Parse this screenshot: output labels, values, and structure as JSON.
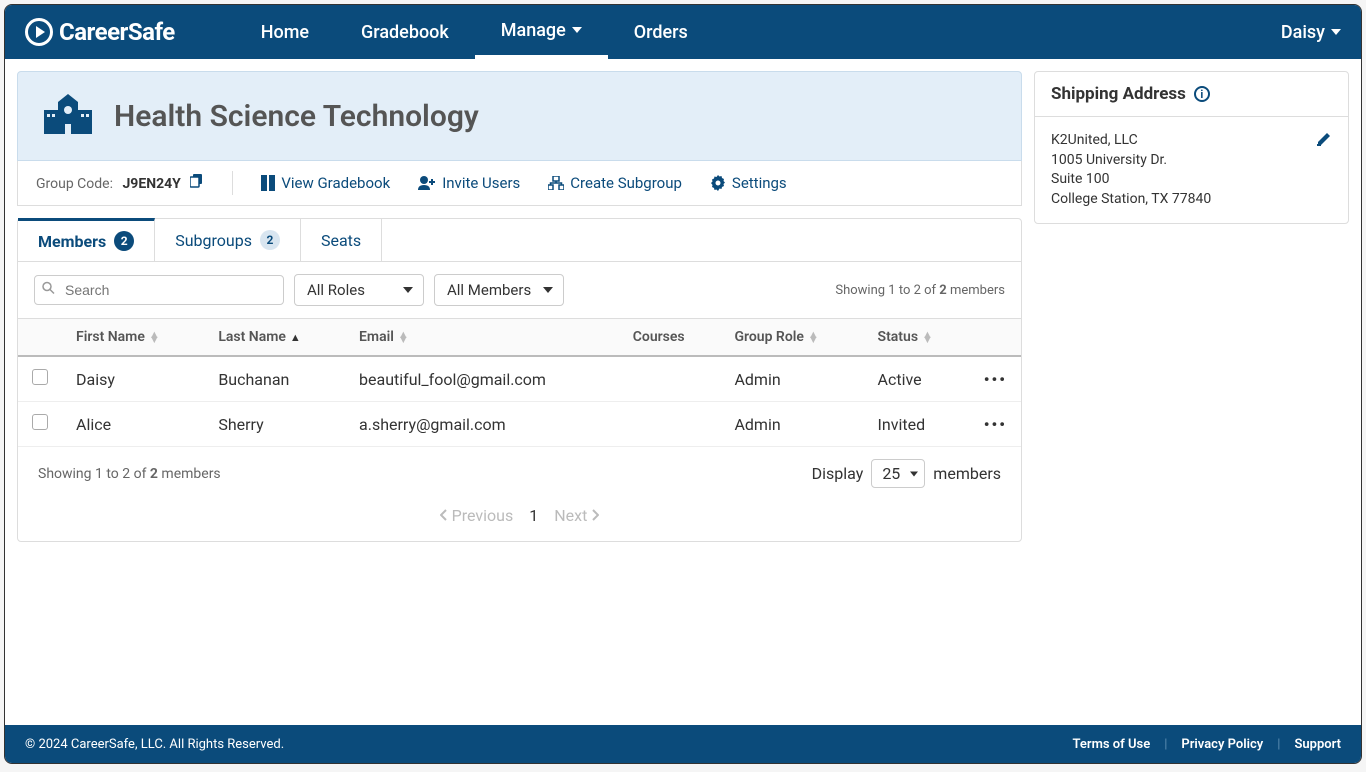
{
  "brand": "CareerSafe",
  "nav": {
    "home": "Home",
    "gradebook": "Gradebook",
    "manage": "Manage",
    "orders": "Orders"
  },
  "user": {
    "name": "Daisy"
  },
  "group": {
    "title": "Health Science Technology",
    "code_label": "Group Code:",
    "code_value": "J9EN24Y"
  },
  "toolbar": {
    "view_gradebook": "View Gradebook",
    "invite_users": "Invite Users",
    "create_subgroup": "Create Subgroup",
    "settings": "Settings"
  },
  "tabs": {
    "members": {
      "label": "Members",
      "count": "2"
    },
    "subgroups": {
      "label": "Subgroups",
      "count": "2"
    },
    "seats": {
      "label": "Seats"
    }
  },
  "filters": {
    "search_placeholder": "Search",
    "roles": "All Roles",
    "members": "All Members"
  },
  "summary": {
    "prefix": "Showing 1 to 2 of ",
    "total": "2",
    "suffix": " members"
  },
  "columns": {
    "first_name": "First Name",
    "last_name": "Last Name",
    "email": "Email",
    "courses": "Courses",
    "group_role": "Group Role",
    "status": "Status"
  },
  "rows": [
    {
      "first": "Daisy",
      "last": "Buchanan",
      "email": "beautiful_fool@gmail.com",
      "courses": "",
      "role": "Admin",
      "status": "Active"
    },
    {
      "first": "Alice",
      "last": "Sherry",
      "email": "a.sherry@gmail.com",
      "courses": "",
      "role": "Admin",
      "status": "Invited"
    }
  ],
  "pager": {
    "display_label": "Display",
    "page_size": "25",
    "members_label": "members",
    "previous": "Previous",
    "next": "Next",
    "current_page": "1"
  },
  "shipping": {
    "title": "Shipping Address",
    "line1": "K2United, LLC",
    "line2": "1005 University Dr.",
    "line3": "Suite 100",
    "line4": "College Station, TX 77840"
  },
  "footer": {
    "copyright": "© 2024 CareerSafe, LLC. All Rights Reserved.",
    "terms": "Terms of Use",
    "privacy": "Privacy Policy",
    "support": "Support"
  }
}
